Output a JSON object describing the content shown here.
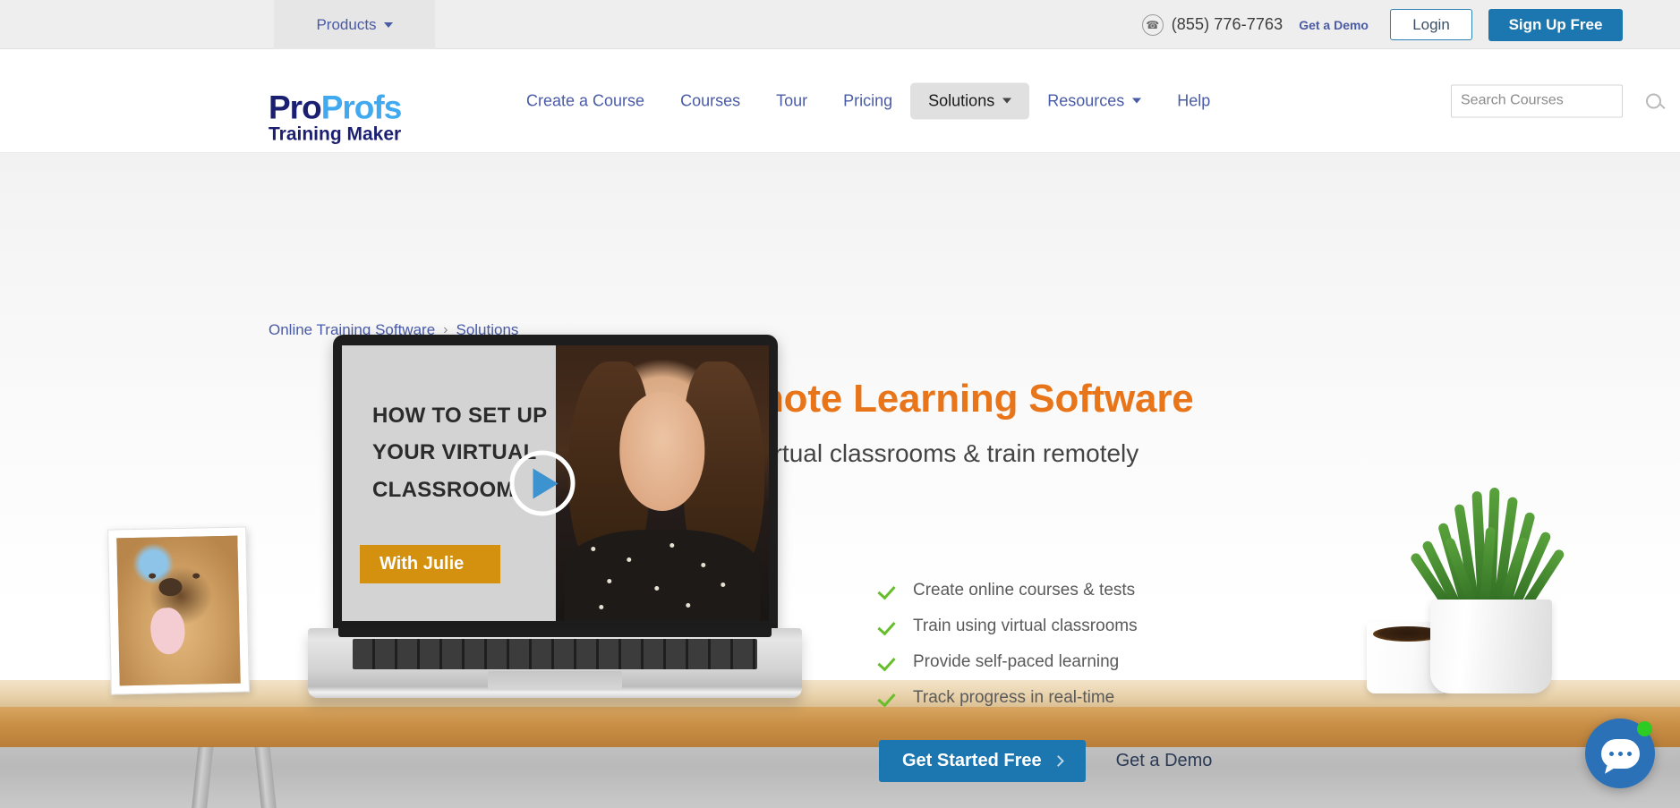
{
  "topbar": {
    "products_label": "Products",
    "phone": "(855) 776-7763",
    "demo_link": "Get a Demo",
    "login_label": "Login",
    "signup_label": "Sign Up Free",
    "phone_icon": "phone-icon",
    "caret_icon": "chevron-down-icon"
  },
  "brand": {
    "logo_part1": "Pro",
    "logo_part2": "Profs",
    "logo_tagline": "Training Maker",
    "color_dark": "#1b1f71",
    "color_light": "#40a9f0"
  },
  "nav": {
    "items": [
      {
        "label": "Create a Course",
        "has_caret": false,
        "active": false
      },
      {
        "label": "Courses",
        "has_caret": false,
        "active": false
      },
      {
        "label": "Tour",
        "has_caret": false,
        "active": false
      },
      {
        "label": "Pricing",
        "has_caret": false,
        "active": false
      },
      {
        "label": "Solutions",
        "has_caret": true,
        "active": true
      },
      {
        "label": "Resources",
        "has_caret": true,
        "active": false
      },
      {
        "label": "Help",
        "has_caret": false,
        "active": false
      }
    ]
  },
  "search": {
    "placeholder": "Search Courses",
    "value": "",
    "icon": "search-icon"
  },
  "breadcrumb": {
    "root": "Online Training Software",
    "separator": "›",
    "current": "Solutions"
  },
  "hero": {
    "title": "Distance & Remote Learning Software",
    "subtitle": "Make the switch to virtual classrooms & train remotely",
    "title_color": "#e8751a"
  },
  "video": {
    "line1": "HOW TO SET UP",
    "line2": "YOUR VIRTUAL",
    "line3": "CLASSROOM",
    "badge": "With Julie",
    "badge_color": "#d4900f",
    "play_icon": "play-icon"
  },
  "features": {
    "items": [
      "Create online courses & tests",
      "Train using virtual classrooms",
      "Provide self-paced learning",
      "Track progress in real-time"
    ],
    "check_color": "#67bd2a"
  },
  "cta": {
    "primary_label": "Get Started Free",
    "primary_color": "#1c76af",
    "secondary_label": "Get a Demo",
    "chevron_icon": "chevron-right-icon"
  },
  "chat": {
    "icon": "chat-bubble-icon",
    "status_icon": "online-status-dot",
    "accent_color": "#2b71b8",
    "status_color": "#2ecc23"
  }
}
